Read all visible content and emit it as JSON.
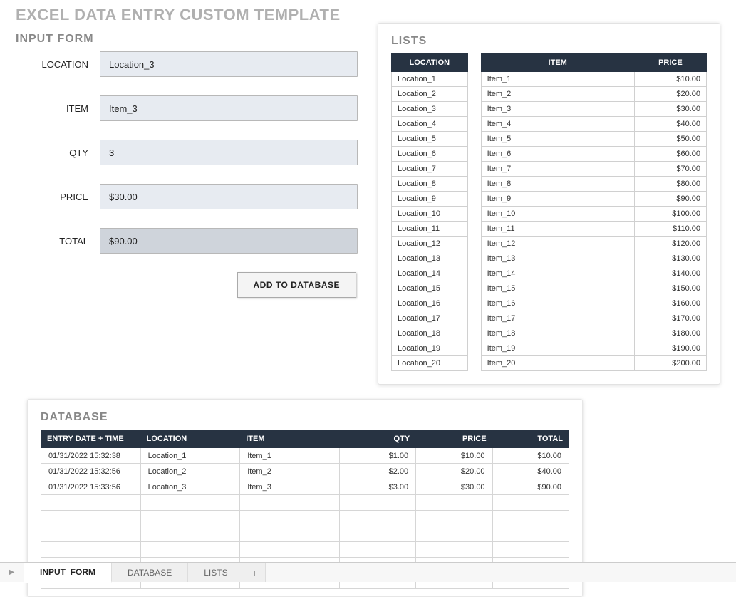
{
  "title": "EXCEL DATA ENTRY CUSTOM TEMPLATE",
  "input_form": {
    "title": "INPUT FORM",
    "labels": {
      "location": "LOCATION",
      "item": "ITEM",
      "qty": "QTY",
      "price": "PRICE",
      "total": "TOTAL"
    },
    "values": {
      "location": "Location_3",
      "item": "Item_3",
      "qty": "3",
      "price": "$30.00",
      "total": "$90.00"
    },
    "add_button": "ADD TO DATABASE"
  },
  "lists": {
    "title": "LISTS",
    "location_header": "LOCATION",
    "item_header": "ITEM",
    "price_header": "PRICE",
    "locations": [
      "Location_1",
      "Location_2",
      "Location_3",
      "Location_4",
      "Location_5",
      "Location_6",
      "Location_7",
      "Location_8",
      "Location_9",
      "Location_10",
      "Location_11",
      "Location_12",
      "Location_13",
      "Location_14",
      "Location_15",
      "Location_16",
      "Location_17",
      "Location_18",
      "Location_19",
      "Location_20"
    ],
    "items": [
      {
        "name": "Item_1",
        "price": "$10.00"
      },
      {
        "name": "Item_2",
        "price": "$20.00"
      },
      {
        "name": "Item_3",
        "price": "$30.00"
      },
      {
        "name": "Item_4",
        "price": "$40.00"
      },
      {
        "name": "Item_5",
        "price": "$50.00"
      },
      {
        "name": "Item_6",
        "price": "$60.00"
      },
      {
        "name": "Item_7",
        "price": "$70.00"
      },
      {
        "name": "Item_8",
        "price": "$80.00"
      },
      {
        "name": "Item_9",
        "price": "$90.00"
      },
      {
        "name": "Item_10",
        "price": "$100.00"
      },
      {
        "name": "Item_11",
        "price": "$110.00"
      },
      {
        "name": "Item_12",
        "price": "$120.00"
      },
      {
        "name": "Item_13",
        "price": "$130.00"
      },
      {
        "name": "Item_14",
        "price": "$140.00"
      },
      {
        "name": "Item_15",
        "price": "$150.00"
      },
      {
        "name": "Item_16",
        "price": "$160.00"
      },
      {
        "name": "Item_17",
        "price": "$170.00"
      },
      {
        "name": "Item_18",
        "price": "$180.00"
      },
      {
        "name": "Item_19",
        "price": "$190.00"
      },
      {
        "name": "Item_20",
        "price": "$200.00"
      }
    ]
  },
  "database": {
    "title": "DATABASE",
    "headers": {
      "entry": "ENTRY DATE + TIME",
      "location": "LOCATION",
      "item": "ITEM",
      "qty": "QTY",
      "price": "PRICE",
      "total": "TOTAL"
    },
    "rows": [
      {
        "entry": "01/31/2022 15:32:38",
        "location": "Location_1",
        "item": "Item_1",
        "qty": "$1.00",
        "price": "$10.00",
        "total": "$10.00"
      },
      {
        "entry": "01/31/2022 15:32:56",
        "location": "Location_2",
        "item": "Item_2",
        "qty": "$2.00",
        "price": "$20.00",
        "total": "$40.00"
      },
      {
        "entry": "01/31/2022 15:33:56",
        "location": "Location_3",
        "item": "Item_3",
        "qty": "$3.00",
        "price": "$30.00",
        "total": "$90.00"
      }
    ],
    "empty_rows": 6
  },
  "tabs": {
    "active": "INPUT_FORM",
    "items": [
      "INPUT_FORM",
      "DATABASE",
      "LISTS"
    ],
    "add": "+"
  }
}
